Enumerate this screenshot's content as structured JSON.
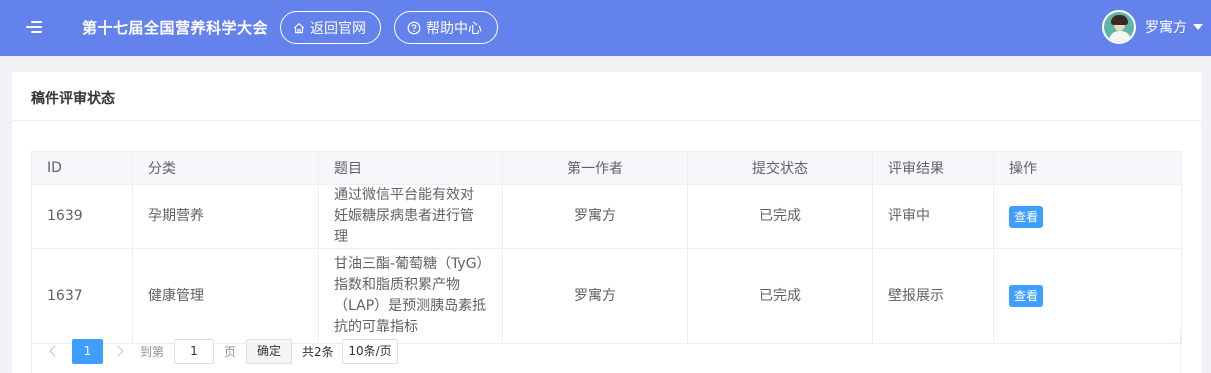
{
  "colors": {
    "header_bg": "#6482ec",
    "primary": "#409eff"
  },
  "header": {
    "title": "第十七届全国营养科学大会",
    "home_button": "返回官网",
    "help_button": "帮助中心",
    "user_name": "罗寓方"
  },
  "card": {
    "title": "稿件评审状态",
    "columns": [
      "ID",
      "分类",
      "题目",
      "第一作者",
      "提交状态",
      "评审结果",
      "操作"
    ],
    "rows": [
      {
        "id": "1639",
        "category": "孕期营养",
        "title": "通过微信平台能有效对妊娠糖尿病患者进行管理",
        "author": "罗寓方",
        "status": "已完成",
        "result": "评审中",
        "action": "查看"
      },
      {
        "id": "1637",
        "category": "健康管理",
        "title": "甘油三酯-葡萄糖（TyG）指数和脂质积累产物（LAP）是预测胰岛素抵抗的可靠指标",
        "author": "罗寓方",
        "status": "已完成",
        "result": "壁报展示",
        "action": "查看"
      }
    ]
  },
  "pagination": {
    "current_page": "1",
    "goto_label": "到第",
    "goto_value": "1",
    "page_unit": "页",
    "confirm": "确定",
    "total": "共2条",
    "page_size": "10条/页"
  }
}
